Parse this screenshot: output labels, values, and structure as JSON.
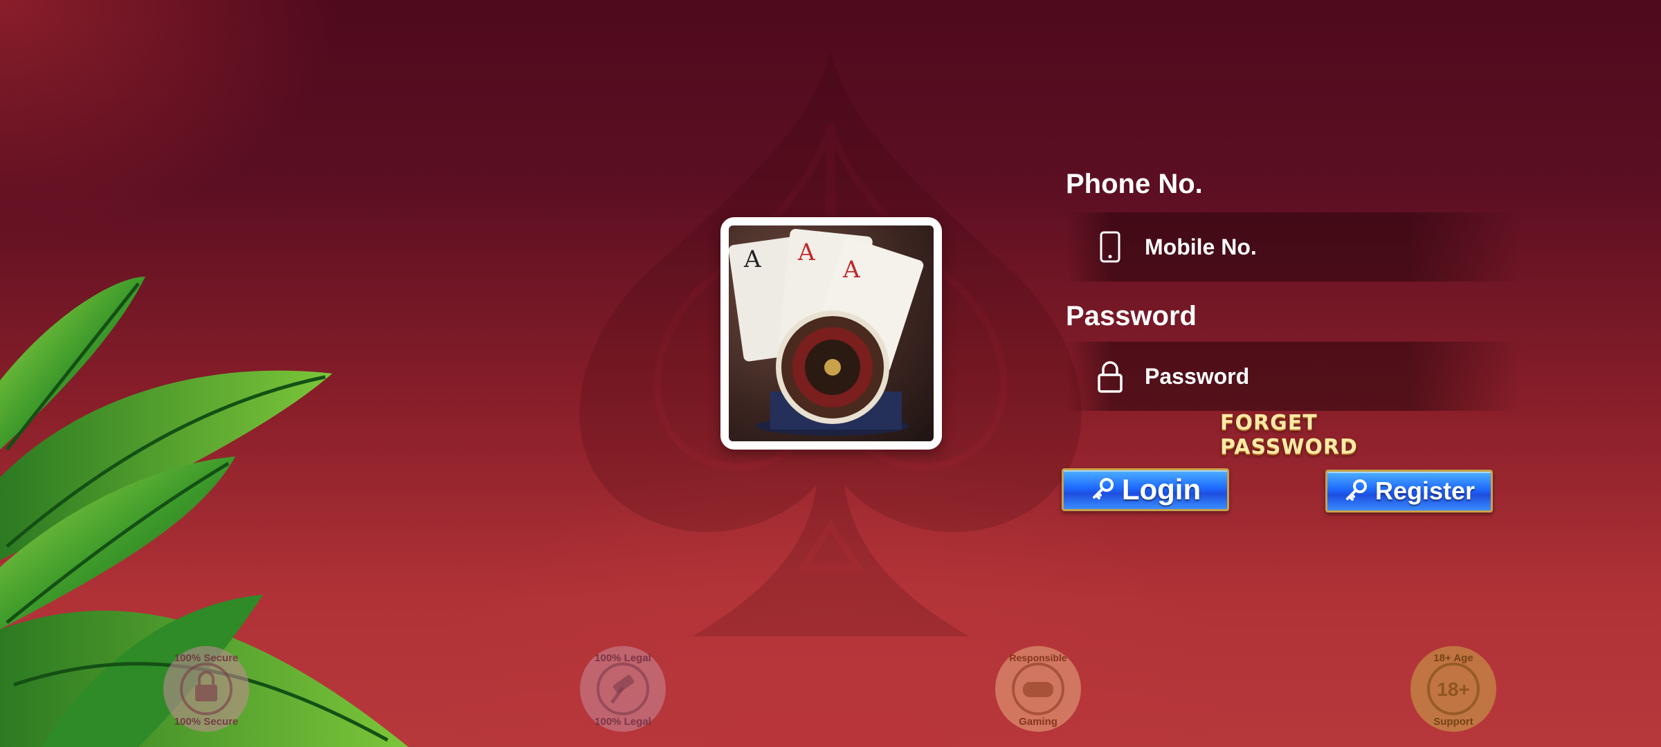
{
  "phone": {
    "label": "Phone No.",
    "placeholder": "Mobile No.",
    "icon": "smartphone-icon"
  },
  "password": {
    "label": "Password",
    "placeholder": "Password",
    "icon": "lock-icon"
  },
  "forget_password": "FORGET PASSWORD",
  "buttons": {
    "login": "Login",
    "register": "Register",
    "icon": "key-icon"
  },
  "badges": [
    {
      "top": "100% Secure",
      "bottom": "100% Secure",
      "center": "lock",
      "color": "#c98a9b"
    },
    {
      "top": "100% Legal",
      "bottom": "100% Legal",
      "center": "gavel",
      "color": "#c98a9b"
    },
    {
      "top": "Responsible",
      "bottom": "Gaming",
      "center": "gamepad",
      "color": "#e09a74"
    },
    {
      "top": "18+ Age",
      "bottom": "Support",
      "center": "18+",
      "color": "#c8a04a"
    }
  ],
  "colors": {
    "background": "#6a1426",
    "button_blue": "#1e6bff",
    "gold": "#c9a24a"
  }
}
